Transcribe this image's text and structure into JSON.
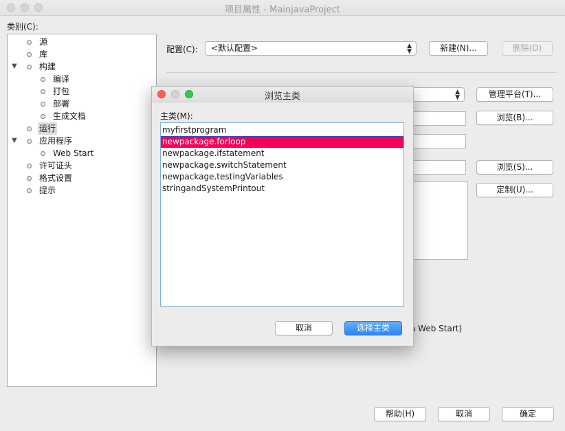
{
  "window": {
    "title": "项目属性 - MainjavaProject"
  },
  "categories_label": "类别(C):",
  "tree": [
    {
      "label": "源"
    },
    {
      "label": "库"
    },
    {
      "label": "构建",
      "expanded": true
    },
    {
      "label": "编译"
    },
    {
      "label": "打包"
    },
    {
      "label": "部署"
    },
    {
      "label": "生成文档"
    },
    {
      "label": "运行",
      "selected": true
    },
    {
      "label": "应用程序",
      "expanded": true
    },
    {
      "label": "Web Start"
    },
    {
      "label": "许可证头"
    },
    {
      "label": "格式设置"
    },
    {
      "label": "提示"
    }
  ],
  "config": {
    "label": "配置(C):",
    "value": "<默认配置>",
    "new_button": "新建(N)...",
    "delete_button": "删除(D)"
  },
  "right_buttons": {
    "manage_platform": "管理平台(T)...",
    "browse_b": "浏览(B)...",
    "browse_s": "浏览(S)...",
    "customize": "定制(U)..."
  },
  "partial_label": "a Web Start)",
  "bottom_buttons": {
    "help": "帮助(H)",
    "cancel": "取消",
    "ok": "确定"
  },
  "dialog": {
    "title": "浏览主类",
    "list_label": "主类(M):",
    "items": [
      "myfirstprogram",
      "newpackage.forloop",
      "newpackage.ifstatement",
      "newpackage.switchStatement",
      "newpackage.testingVariables",
      "stringandSystemPrintout"
    ],
    "selected_index": 1,
    "cancel_button": "取消",
    "select_button": "选择主类"
  },
  "colors": {
    "selection": "#f5005a",
    "primary_button": "#2b86f5",
    "close_light": "#fc605b",
    "minimize_light": "#cfcfcf",
    "zoom_light": "#34c84a"
  }
}
